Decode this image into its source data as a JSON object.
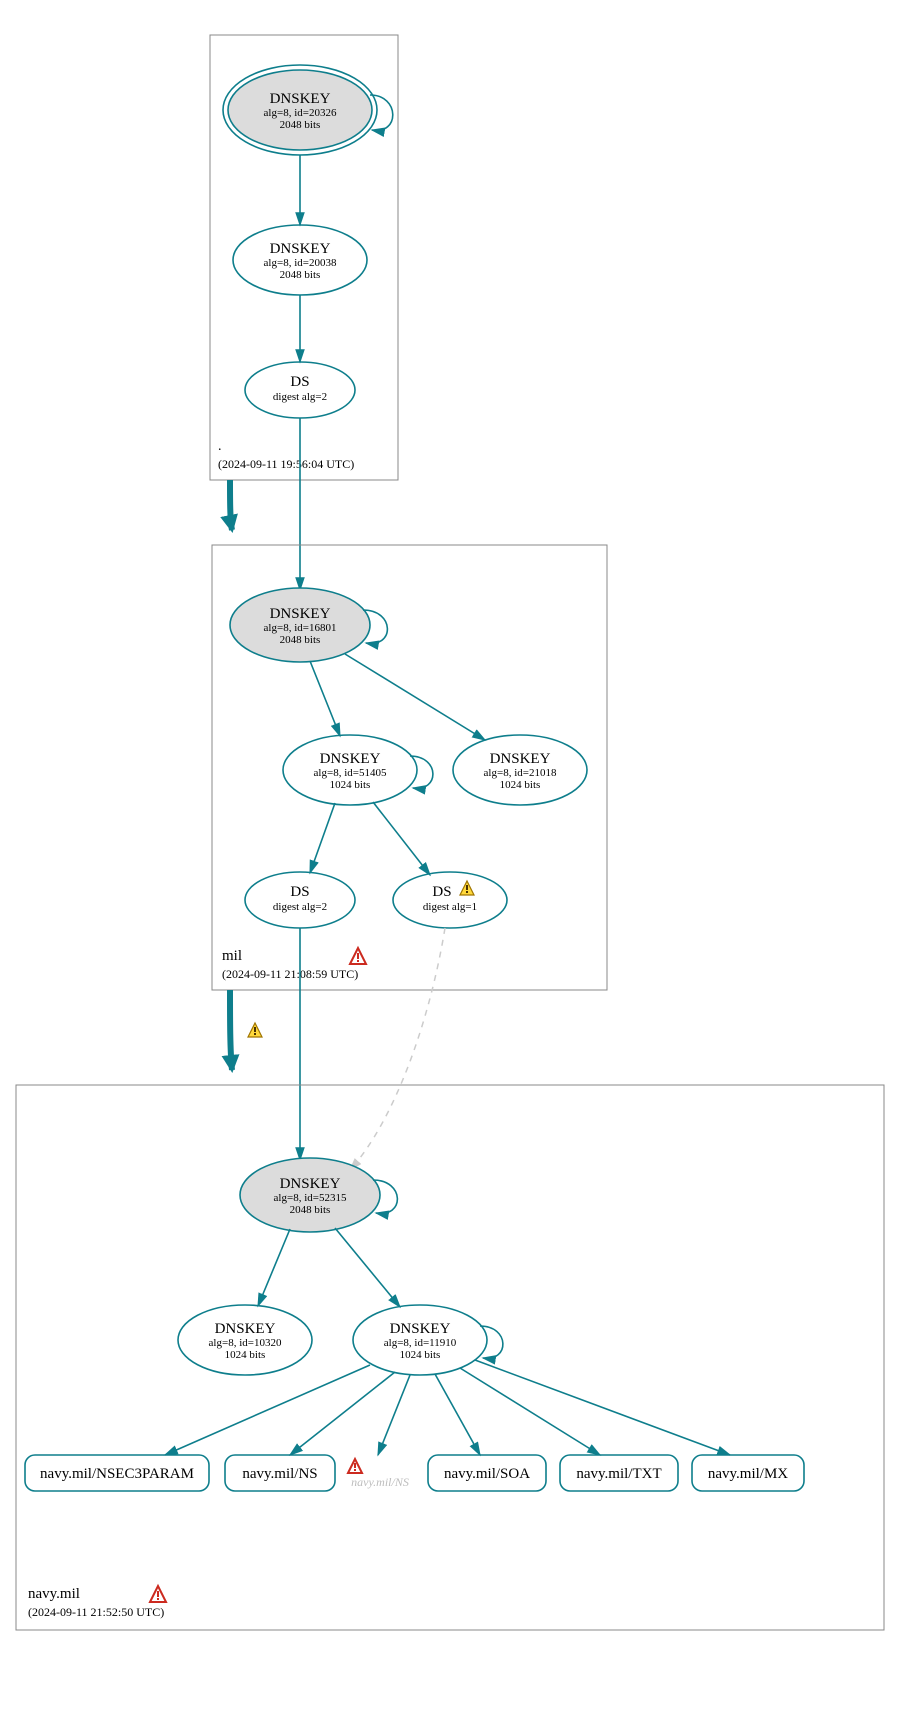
{
  "zones": {
    "root": {
      "label": ".",
      "timestamp": "(2024-09-11 19:56:04 UTC)",
      "nodes": {
        "dnskey_ksk": {
          "title": "DNSKEY",
          "line1": "alg=8, id=20326",
          "line2": "2048 bits"
        },
        "dnskey_zsk": {
          "title": "DNSKEY",
          "line1": "alg=8, id=20038",
          "line2": "2048 bits"
        },
        "ds": {
          "title": "DS",
          "line1": "digest alg=2"
        }
      }
    },
    "mil": {
      "label": "mil",
      "timestamp": "(2024-09-11 21:08:59 UTC)",
      "nodes": {
        "dnskey_ksk": {
          "title": "DNSKEY",
          "line1": "alg=8, id=16801",
          "line2": "2048 bits"
        },
        "dnskey_zsk": {
          "title": "DNSKEY",
          "line1": "alg=8, id=51405",
          "line2": "1024 bits"
        },
        "dnskey_other": {
          "title": "DNSKEY",
          "line1": "alg=8, id=21018",
          "line2": "1024 bits"
        },
        "ds1": {
          "title": "DS",
          "line1": "digest alg=2"
        },
        "ds2": {
          "title": "DS",
          "line1": "digest alg=1"
        }
      }
    },
    "navy": {
      "label": "navy.mil",
      "timestamp": "(2024-09-11 21:52:50 UTC)",
      "nodes": {
        "dnskey_ksk": {
          "title": "DNSKEY",
          "line1": "alg=8, id=52315",
          "line2": "2048 bits"
        },
        "dnskey_other": {
          "title": "DNSKEY",
          "line1": "alg=8, id=10320",
          "line2": "1024 bits"
        },
        "dnskey_zsk": {
          "title": "DNSKEY",
          "line1": "alg=8, id=11910",
          "line2": "1024 bits"
        },
        "rr1": "navy.mil/NSEC3PARAM",
        "rr2": "navy.mil/NS",
        "rr3": "navy.mil/SOA",
        "rr4": "navy.mil/TXT",
        "rr5": "navy.mil/MX",
        "ghost_ns": "navy.mil/NS"
      }
    }
  }
}
